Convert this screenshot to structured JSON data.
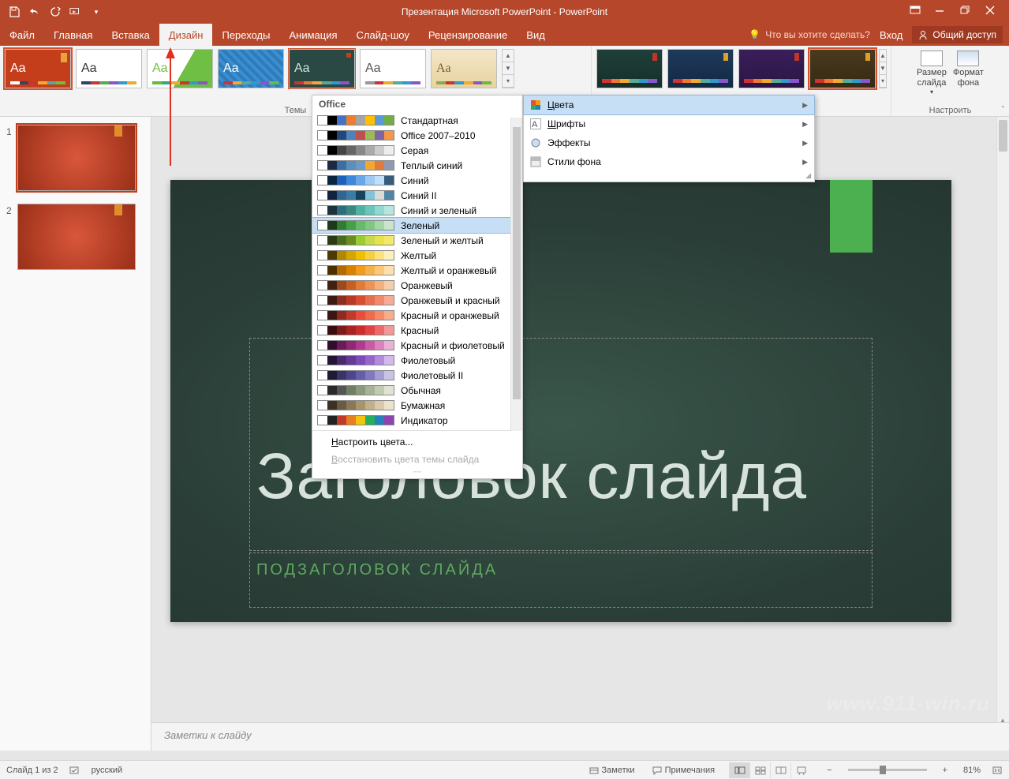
{
  "title": "Презентация Microsoft PowerPoint - PowerPoint",
  "ribbon_tabs": [
    "Файл",
    "Главная",
    "Вставка",
    "Дизайн",
    "Переходы",
    "Анимация",
    "Слайд-шоу",
    "Рецензирование",
    "Вид"
  ],
  "active_tab_index": 3,
  "tellme_placeholder": "Что вы хотите сделать?",
  "login_label": "Вход",
  "share_label": "Общий доступ",
  "themes_group_label": "Темы",
  "customize_group_label": "Настроить",
  "slide_size_label": "Размер\nслайда",
  "bg_format_label": "Формат\nфона",
  "variant_menu": {
    "colors": "Цвета",
    "fonts": "Шрифты",
    "effects": "Эффекты",
    "bg_styles": "Стили фона"
  },
  "colors_menu": {
    "header": "Office",
    "items": [
      {
        "label": "Стандартная",
        "c": [
          "#fff",
          "#000",
          "#4472c4",
          "#ed7d31",
          "#a5a5a5",
          "#ffc000",
          "#5b9bd5",
          "#70ad47"
        ]
      },
      {
        "label": "Office 2007–2010",
        "c": [
          "#fff",
          "#000",
          "#1f497d",
          "#4f81bd",
          "#c0504d",
          "#9bbb59",
          "#8064a2",
          "#f79646"
        ]
      },
      {
        "label": "Серая",
        "c": [
          "#fff",
          "#000",
          "#444",
          "#666",
          "#888",
          "#aaa",
          "#ccc",
          "#eee"
        ]
      },
      {
        "label": "Теплый синий",
        "c": [
          "#fff",
          "#1b2a41",
          "#3a6ea5",
          "#5b8fb9",
          "#6b9ac4",
          "#f0a830",
          "#e07b39",
          "#8e9aaf"
        ]
      },
      {
        "label": "Синий",
        "c": [
          "#fff",
          "#0a2540",
          "#1e61b8",
          "#3f87dc",
          "#68a8e8",
          "#9ec9f3",
          "#c3def9",
          "#355c7d"
        ]
      },
      {
        "label": "Синий II",
        "c": [
          "#fff",
          "#10243e",
          "#2f6690",
          "#3a7ca5",
          "#16425b",
          "#81c3d7",
          "#d9dcd6",
          "#5085a5"
        ]
      },
      {
        "label": "Синий и зеленый",
        "c": [
          "#fff",
          "#19323c",
          "#2d6e7e",
          "#3c887e",
          "#4eb1a3",
          "#6cc5bb",
          "#8fd9cf",
          "#b4e7df"
        ]
      },
      {
        "label": "Зеленый",
        "c": [
          "#fff",
          "#1b3a1b",
          "#2e7d32",
          "#43a047",
          "#66bb6a",
          "#81c784",
          "#a5d6a7",
          "#c8e6c9"
        ]
      },
      {
        "label": "Зеленый и желтый",
        "c": [
          "#fff",
          "#2a3b13",
          "#4b6b1f",
          "#6b8e23",
          "#9acd32",
          "#c8d94c",
          "#e6e34c",
          "#f2e96b"
        ]
      },
      {
        "label": "Желтый",
        "c": [
          "#fff",
          "#4a3b00",
          "#b08900",
          "#d4a600",
          "#f0c000",
          "#f6d043",
          "#fbe180",
          "#fdf0bf"
        ]
      },
      {
        "label": "Желтый и оранжевый",
        "c": [
          "#fff",
          "#4a2f00",
          "#b36a00",
          "#d98200",
          "#f29b1f",
          "#f6b24a",
          "#fac878",
          "#fde0ab"
        ]
      },
      {
        "label": "Оранжевый",
        "c": [
          "#fff",
          "#3e2410",
          "#9c4a1a",
          "#c85f22",
          "#e07b39",
          "#ea9556",
          "#f2b07d",
          "#f8cdaa"
        ]
      },
      {
        "label": "Оранжевый и красный",
        "c": [
          "#fff",
          "#3a1a12",
          "#8b2e1f",
          "#b83a26",
          "#d94e33",
          "#e76f51",
          "#f08a6e",
          "#f7ab97"
        ]
      },
      {
        "label": "Красный и оранжевый",
        "c": [
          "#fff",
          "#3a1512",
          "#8e2a1f",
          "#c0392b",
          "#e74c3c",
          "#f06a4c",
          "#f58a66",
          "#f9ac8b"
        ]
      },
      {
        "label": "Красный",
        "c": [
          "#fff",
          "#3a0e0e",
          "#7d1a1a",
          "#a82424",
          "#cc2e2e",
          "#e04545",
          "#ea6b6b",
          "#f29a9a"
        ]
      },
      {
        "label": "Красный и фиолетовый",
        "c": [
          "#fff",
          "#2f0e2a",
          "#6a1b5b",
          "#8e2a74",
          "#b23a8e",
          "#c95aa6",
          "#db82bd",
          "#eab0d6"
        ]
      },
      {
        "label": "Фиолетовый",
        "c": [
          "#fff",
          "#241537",
          "#4a2a6e",
          "#633a94",
          "#7d4bb8",
          "#9766cc",
          "#b48cdc",
          "#d3b9ec"
        ]
      },
      {
        "label": "Фиолетовый II",
        "c": [
          "#fff",
          "#1e1a33",
          "#3a3366",
          "#4e468a",
          "#655caa",
          "#8178c1",
          "#a39cd5",
          "#c8c4e8"
        ]
      },
      {
        "label": "Обычная",
        "c": [
          "#fff",
          "#2a2a2a",
          "#555",
          "#6e7f64",
          "#8a9a7b",
          "#a6b495",
          "#c3ccb2",
          "#e0e4d4"
        ]
      },
      {
        "label": "Бумажная",
        "c": [
          "#fff",
          "#3b3024",
          "#6b5a42",
          "#8a775a",
          "#a8946f",
          "#c2b08a",
          "#d8caa8",
          "#ece3cc"
        ]
      },
      {
        "label": "Индикатор",
        "c": [
          "#fff",
          "#222",
          "#c0392b",
          "#e67e22",
          "#f1c40f",
          "#27ae60",
          "#2980b9",
          "#8e44ad"
        ]
      }
    ],
    "customize": "Настроить цвета...",
    "reset": "Восстановить цвета темы слайда",
    "selected_index": 7
  },
  "slide": {
    "title_placeholder": "Заголовок слайда",
    "subtitle_placeholder": "ПОДЗАГОЛОВОК СЛАЙДА"
  },
  "notes_placeholder": "Заметки к слайду",
  "status": {
    "slide_counter": "Слайд 1 из 2",
    "language": "русский",
    "notes_btn": "Заметки",
    "comments_btn": "Примечания",
    "zoom": "81%"
  },
  "watermark": "www.911-win.ru",
  "thumbnails": [
    1,
    2
  ],
  "variant_colors": [
    {
      "bg": "linear-gradient(#1f3f3a,#163029)",
      "accent": "#c2342a"
    },
    {
      "bg": "linear-gradient(#1e3a5a,#142944)",
      "accent": "#d9a02a"
    },
    {
      "bg": "linear-gradient(#3a1e5a,#2a1644)",
      "accent": "#c2342a"
    },
    {
      "bg": "linear-gradient(#4a3a1e,#362a14)",
      "accent": "#d9a02a"
    }
  ]
}
